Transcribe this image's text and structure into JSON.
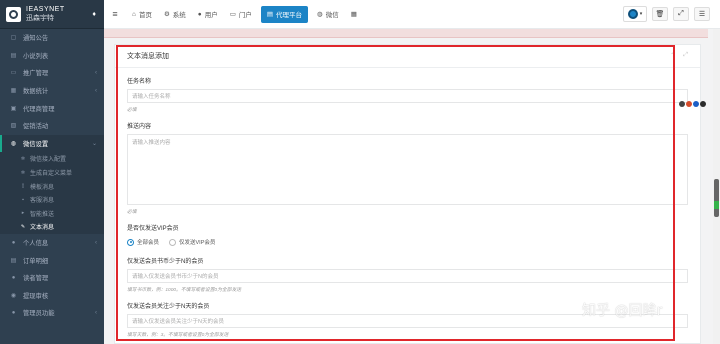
{
  "brand": {
    "name": "IEASYNET",
    "subtitle": "迅森宇特",
    "drop_icon": "drop-icon"
  },
  "sidebar": {
    "items": [
      {
        "label": "通知公告",
        "icon": "bell-icon",
        "has_arrow": false
      },
      {
        "label": "小说列表",
        "icon": "book-icon",
        "has_arrow": false
      },
      {
        "label": "推广管理",
        "icon": "share-icon",
        "has_arrow": true
      },
      {
        "label": "数据统计",
        "icon": "chart-icon",
        "has_arrow": true
      },
      {
        "label": "代理商管理",
        "icon": "agent-icon",
        "has_arrow": false
      },
      {
        "label": "促销活动",
        "icon": "gift-icon",
        "has_arrow": false
      },
      {
        "label": "微信设置",
        "icon": "wechat-icon",
        "has_arrow": true,
        "open": true
      },
      {
        "label": "微信接入配置",
        "sub": true
      },
      {
        "label": "生成自定义菜单",
        "sub": true
      },
      {
        "label": "模板消息",
        "sub": true
      },
      {
        "label": "客服消息",
        "sub": true
      },
      {
        "label": "智能推送",
        "sub": true
      },
      {
        "label": "文本消息",
        "sub": true,
        "active": true
      },
      {
        "label": "个人信息",
        "icon": "user-icon",
        "has_arrow": true
      },
      {
        "label": "订单明细",
        "icon": "order-icon",
        "has_arrow": false
      },
      {
        "label": "读者管理",
        "icon": "reader-icon",
        "has_arrow": false
      },
      {
        "label": "提现审核",
        "icon": "money-icon",
        "has_arrow": false
      },
      {
        "label": "管理员功能",
        "icon": "admin-icon",
        "has_arrow": true
      }
    ]
  },
  "topbar": {
    "nav": [
      {
        "label": "首页",
        "icon": "home-icon",
        "glyph": "⌂"
      },
      {
        "label": "系统",
        "icon": "gear-icon",
        "glyph": "⚙"
      },
      {
        "label": "用户",
        "icon": "user-icon",
        "glyph": "●"
      },
      {
        "label": "门户",
        "icon": "portal-icon",
        "glyph": "▭"
      },
      {
        "label": "代理平台",
        "icon": "platform-icon",
        "glyph": "▤",
        "active": true
      },
      {
        "label": "微信",
        "icon": "wechat-icon",
        "glyph": "◍"
      }
    ],
    "grid_icon": "grid-icon"
  },
  "form": {
    "title": "文本消息添加",
    "task_name_label": "任务名称",
    "task_name_placeholder": "请输入任务名称",
    "task_name_hint": "必填",
    "content_label": "推送内容",
    "content_placeholder": "请输入推送内容",
    "content_hint": "必填",
    "vip_label": "是否仅发送VIP会员",
    "vip_options": [
      "全部会员",
      "仅发送VIP会员"
    ],
    "vip_selected": 0,
    "coins_label": "仅发送会员书币少于N的会员",
    "coins_placeholder": "请输入仅发送会员书币少于N的会员",
    "coins_hint": "填写书币数，例：1000。不填写或者设置0为全部发送",
    "days_label": "仅发送会员关注少于N天的会员",
    "days_placeholder": "请输入仅发送会员关注少于N天的会员",
    "days_hint": "填写天数，例：3。不填写或者设置0为全部发送"
  },
  "watermark": "知乎 @回眸r",
  "colors": {
    "sidebar_bg": "#2f4050",
    "accent": "#1c84c6",
    "highlight_border": "#e0262b"
  }
}
